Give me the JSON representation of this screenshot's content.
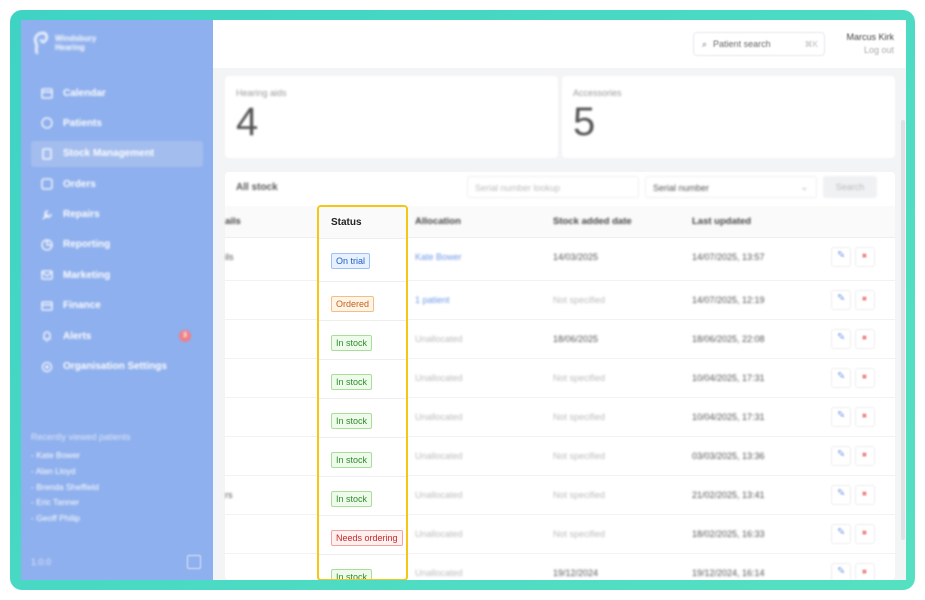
{
  "app": {
    "brand": "Windsbury Hearing",
    "version": "1.0.0"
  },
  "sidebar": {
    "items": [
      {
        "label": "Calendar",
        "icon": "calendar-icon"
      },
      {
        "label": "Patients",
        "icon": "patients-icon"
      },
      {
        "label": "Stock Management",
        "icon": "stock-icon",
        "active": true
      },
      {
        "label": "Orders",
        "icon": "orders-icon"
      },
      {
        "label": "Repairs",
        "icon": "wrench-icon"
      },
      {
        "label": "Reporting",
        "icon": "chart-icon"
      },
      {
        "label": "Marketing",
        "icon": "mail-icon"
      },
      {
        "label": "Finance",
        "icon": "card-icon"
      },
      {
        "label": "Alerts",
        "icon": "bell-icon",
        "badge": "3"
      },
      {
        "label": "Organisation Settings",
        "icon": "gear-icon"
      }
    ],
    "recent_title": "Recently viewed patients",
    "recent": [
      "- Kate Bower",
      "- Alan Lloyd",
      "- Brenda Sheffield",
      "- Eric Tanner",
      "- Geoff Philip"
    ]
  },
  "topbar": {
    "search_label": "Patient search",
    "shortcut": "⌘K",
    "user_name": "Marcus Kirk",
    "logout": "Log out"
  },
  "stats": [
    {
      "label": "Hearing aids",
      "value": "4"
    },
    {
      "label": "Accessories",
      "value": "5"
    }
  ],
  "toolbar": {
    "title": "All stock",
    "serial_placeholder": "Serial number lookup",
    "filter_value": "Serial number",
    "search_label": "Search"
  },
  "table": {
    "headers": {
      "details": "ails",
      "status": "Status",
      "allocation": "Allocation",
      "added": "Stock added date",
      "updated": "Last updated"
    },
    "rows": [
      {
        "details": "ils",
        "status": "On trial",
        "status_color": "blue",
        "allocation": "Kate Bower",
        "allocation_link": true,
        "added": "14/03/2025",
        "updated": "14/07/2025, 13:57"
      },
      {
        "details": "",
        "status": "Ordered",
        "status_color": "orange",
        "allocation": "1 patient",
        "allocation_link": true,
        "added": "Not specified",
        "updated": "14/07/2025, 12:19"
      },
      {
        "details": "",
        "status": "In stock",
        "status_color": "green",
        "allocation": "Unallocated",
        "allocation_link": false,
        "added": "18/06/2025",
        "updated": "18/06/2025, 22:08"
      },
      {
        "details": "",
        "status": "In stock",
        "status_color": "green",
        "allocation": "Unallocated",
        "allocation_link": false,
        "added": "Not specified",
        "updated": "10/04/2025, 17:31"
      },
      {
        "details": "",
        "status": "In stock",
        "status_color": "green",
        "allocation": "Unallocated",
        "allocation_link": false,
        "added": "Not specified",
        "updated": "10/04/2025, 17:31"
      },
      {
        "details": "",
        "status": "In stock",
        "status_color": "green",
        "allocation": "Unallocated",
        "allocation_link": false,
        "added": "Not specified",
        "updated": "03/03/2025, 13:36"
      },
      {
        "details": "rs",
        "status": "In stock",
        "status_color": "green",
        "allocation": "Unallocated",
        "allocation_link": false,
        "added": "Not specified",
        "updated": "21/02/2025, 13:41"
      },
      {
        "details": "",
        "status": "Needs ordering",
        "status_color": "red",
        "allocation": "Unallocated",
        "allocation_link": false,
        "added": "Not specified",
        "updated": "18/02/2025, 16:33"
      },
      {
        "details": "",
        "status": "In stock",
        "status_color": "green",
        "allocation": "Unallocated",
        "allocation_link": false,
        "added": "19/12/2024",
        "updated": "19/12/2024, 16:14"
      }
    ]
  },
  "colors": {
    "sidebar": "#8fb0ee",
    "frame": "#3fd3c4",
    "highlight": "#f5c518"
  }
}
